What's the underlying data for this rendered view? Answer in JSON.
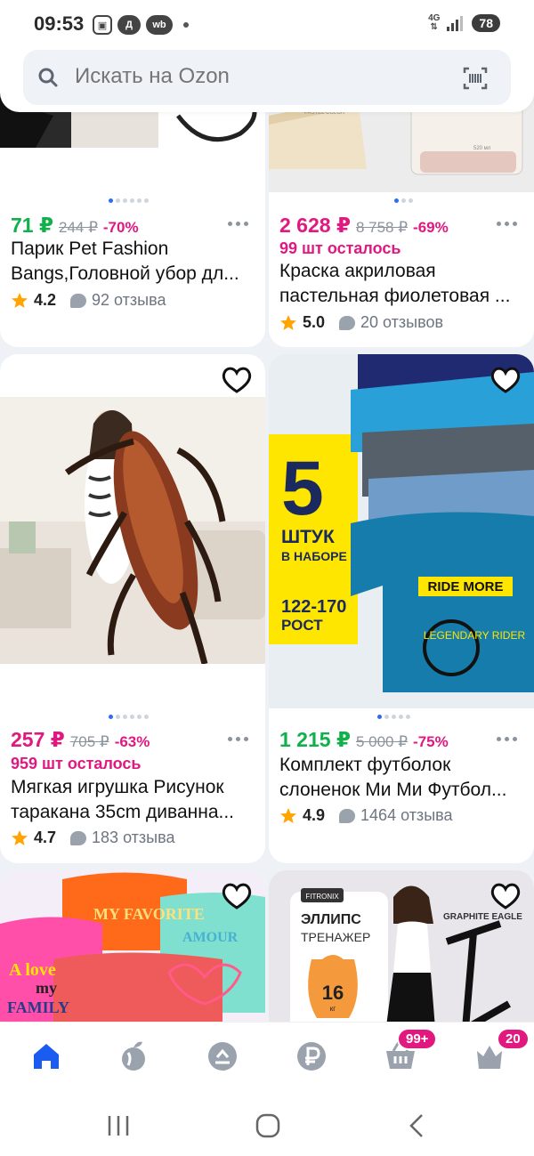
{
  "status_bar": {
    "time": "09:53",
    "network": "4G",
    "battery": "78",
    "notif_icons": [
      "screenshot-icon",
      "d-icon",
      "wb-icon"
    ]
  },
  "search": {
    "placeholder": "Искать на Ozon"
  },
  "products": [
    {
      "price": "71 ₽",
      "old_price": "244 ₽",
      "discount": "-70%",
      "price_color": "green",
      "stock": "",
      "title": "Парик Pet Fashion Bangs,Головной убор дл...",
      "rating": "4.2",
      "reviews": "92 отзыва"
    },
    {
      "price": "2 628 ₽",
      "old_price": "8 758 ₽",
      "discount": "-69%",
      "price_color": "pink",
      "stock": "99 шт осталось",
      "title": "Краска акриловая пастельная фиолетовая ...",
      "rating": "5.0",
      "reviews": "20 отзывов"
    },
    {
      "price": "257 ₽",
      "old_price": "705 ₽",
      "discount": "-63%",
      "price_color": "pink",
      "stock": "959 шт осталось",
      "title": "Мягкая игрушка Рисунок таракана 35cm диванна...",
      "rating": "4.7",
      "reviews": "183 отзыва"
    },
    {
      "price": "1 215 ₽",
      "old_price": "5 000 ₽",
      "discount": "-75%",
      "price_color": "green",
      "stock": "",
      "title": "Комплект футболок слоненок Ми Ми Футбол...",
      "rating": "4.9",
      "reviews": "1464 отзыва"
    }
  ],
  "banners": {
    "tshirts": {
      "count": "5",
      "count_label": "ШТУК\nВ НАБОРЕ",
      "sizes": "122-170",
      "sizes_label": "РОСТ",
      "shirt_text": "RIDE MORE",
      "shirt_sub": "LEGENDARY RIDER"
    },
    "ellipse": {
      "brand": "FITRONIX",
      "title": "ЭЛЛИПС",
      "subtitle": "ТРЕНАЖЕР",
      "weight": "16",
      "weight_unit": "кг",
      "model": "GRAPHITE EAGLE"
    },
    "kids_tshirts": {
      "line1": "A love",
      "line2": "my",
      "line3": "FAMILY",
      "shirt2": "AMOUR",
      "shirt3": "MY FAVORITE"
    },
    "paint_label": "PASTEL COLOR",
    "paint_volume": "520 мл"
  },
  "bottom_nav": {
    "items": [
      "home-icon",
      "fresh-icon",
      "favorites-icon",
      "finance-icon",
      "cart-icon",
      "profile-icon"
    ],
    "cart_badge": "99+",
    "profile_badge": "20",
    "active_color": "#1a5cf0",
    "icon_color": "#9aa3ad"
  }
}
